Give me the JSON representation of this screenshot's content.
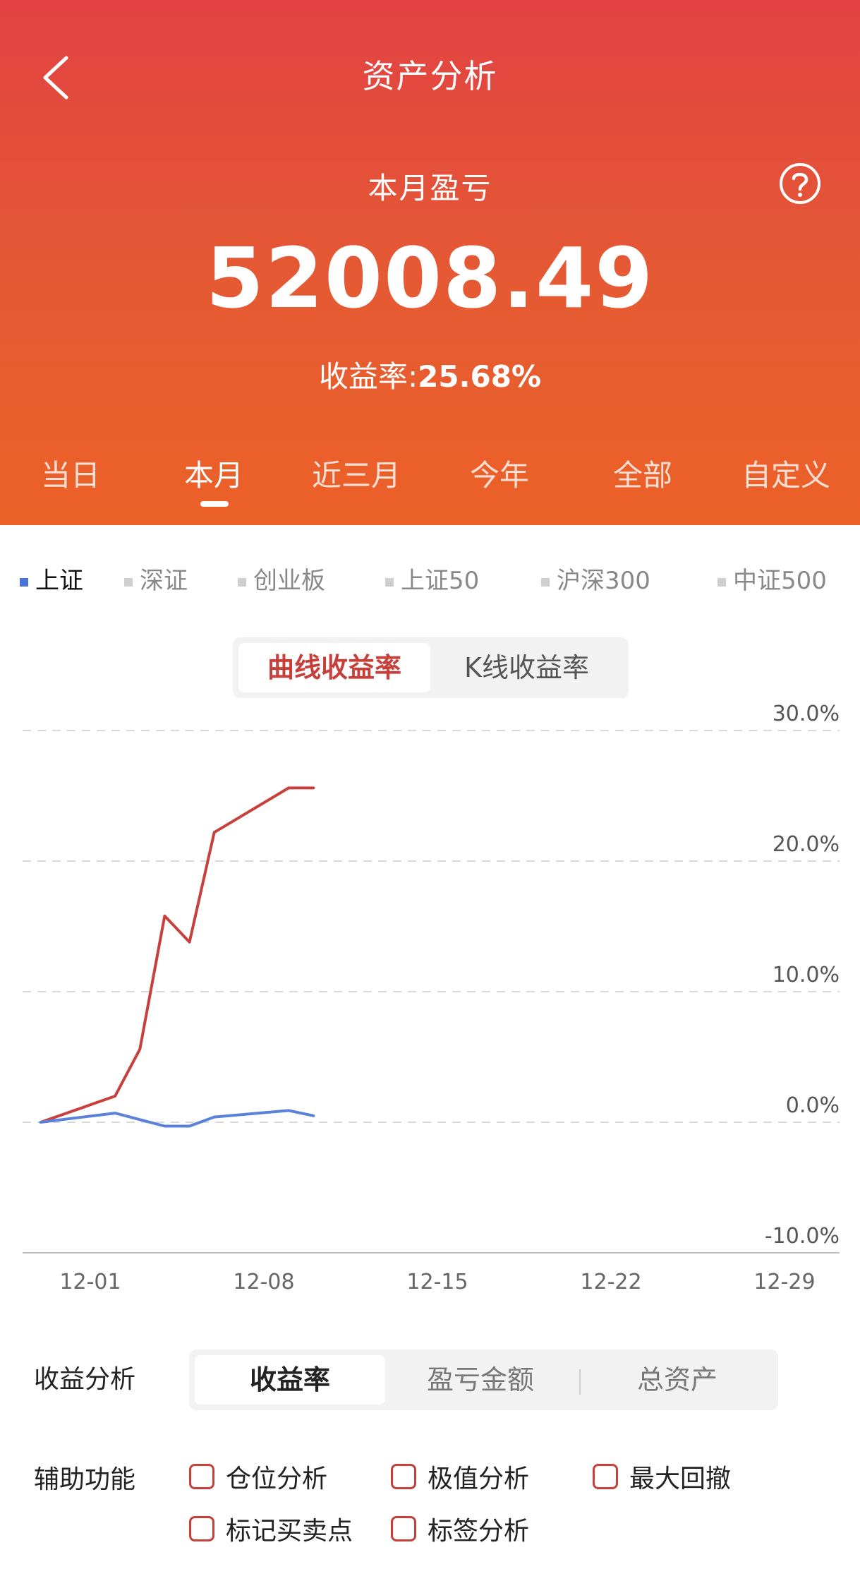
{
  "header": {
    "title": "资产分析",
    "period_label": "本月盈亏",
    "amount": "52008.49",
    "rate_label": "收益率:",
    "rate_value": "25.68%",
    "accent_color": "#e24243"
  },
  "period_tabs": [
    {
      "label": "当日",
      "active": false
    },
    {
      "label": "本月",
      "active": true
    },
    {
      "label": "近三月",
      "active": false
    },
    {
      "label": "今年",
      "active": false
    },
    {
      "label": "全部",
      "active": false
    },
    {
      "label": "自定义",
      "active": false
    }
  ],
  "index_tabs": [
    {
      "label": "上证",
      "active": true
    },
    {
      "label": "深证",
      "active": false
    },
    {
      "label": "创业板",
      "active": false
    },
    {
      "label": "上证50",
      "active": false
    },
    {
      "label": "沪深300",
      "active": false
    },
    {
      "label": "中证500",
      "active": false
    }
  ],
  "chart_mode": {
    "options": [
      "曲线收益率",
      "K线收益率"
    ],
    "selected": "曲线收益率"
  },
  "chart_data": {
    "type": "line",
    "x_tick_labels": [
      "12-01",
      "12-08",
      "12-15",
      "12-22",
      "12-29"
    ],
    "y_tick_labels": [
      "30.0%",
      "20.0%",
      "10.0%",
      "0.0%",
      "-10.0%"
    ],
    "ylim": [
      -10,
      30
    ],
    "grid": true,
    "series": [
      {
        "color": "#c8403c",
        "x": [
          "11-29",
          "12-02",
          "12-03",
          "12-04",
          "12-05",
          "12-06",
          "12-09",
          "12-10"
        ],
        "values": [
          0.0,
          2.0,
          5.6,
          15.8,
          13.8,
          22.2,
          25.6,
          25.6
        ]
      },
      {
        "color": "#5a82d8",
        "x": [
          "11-29",
          "12-02",
          "12-03",
          "12-04",
          "12-05",
          "12-06",
          "12-09",
          "12-10"
        ],
        "values": [
          0.0,
          0.7,
          0.2,
          -0.3,
          -0.3,
          0.4,
          0.9,
          0.5
        ]
      }
    ]
  },
  "profit_analysis": {
    "label": "收益分析",
    "options": [
      "收益率",
      "盈亏金额",
      "总资产"
    ],
    "selected": "收益率"
  },
  "aux": {
    "label": "辅助功能",
    "items": [
      "仓位分析",
      "极值分析",
      "最大回撤",
      "标记买卖点",
      "标签分析"
    ]
  }
}
